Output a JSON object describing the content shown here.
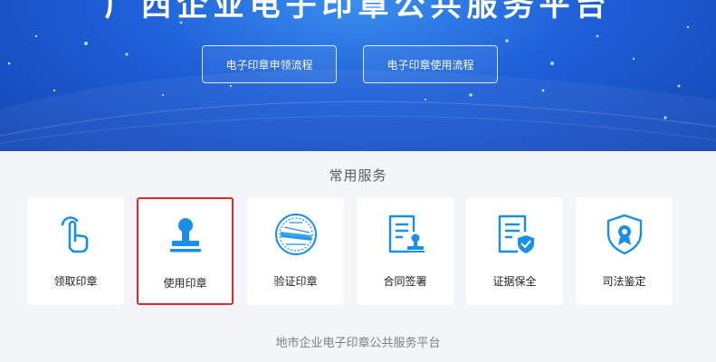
{
  "banner": {
    "title": "广西企业电子印章公共服务平台",
    "buttons": [
      {
        "label": "电子印章申领流程"
      },
      {
        "label": "电子印章使用流程"
      }
    ]
  },
  "services": {
    "title": "常用服务",
    "items": [
      {
        "label": "领取印章",
        "icon": "hand-tap-icon"
      },
      {
        "label": "使用印章",
        "icon": "stamp-icon",
        "selected": true
      },
      {
        "label": "验证印章",
        "icon": "seal-verify-icon"
      },
      {
        "label": "合同签署",
        "icon": "contract-sign-icon"
      },
      {
        "label": "证据保全",
        "icon": "evidence-shield-icon"
      },
      {
        "label": "司法鉴定",
        "icon": "judicial-badge-icon"
      }
    ]
  },
  "footer": {
    "text": "地市企业电子印章公共服务平台"
  },
  "colors": {
    "accent": "#1a8fe8",
    "banner": "#1e5fd8",
    "selection": "#e02a2a"
  }
}
